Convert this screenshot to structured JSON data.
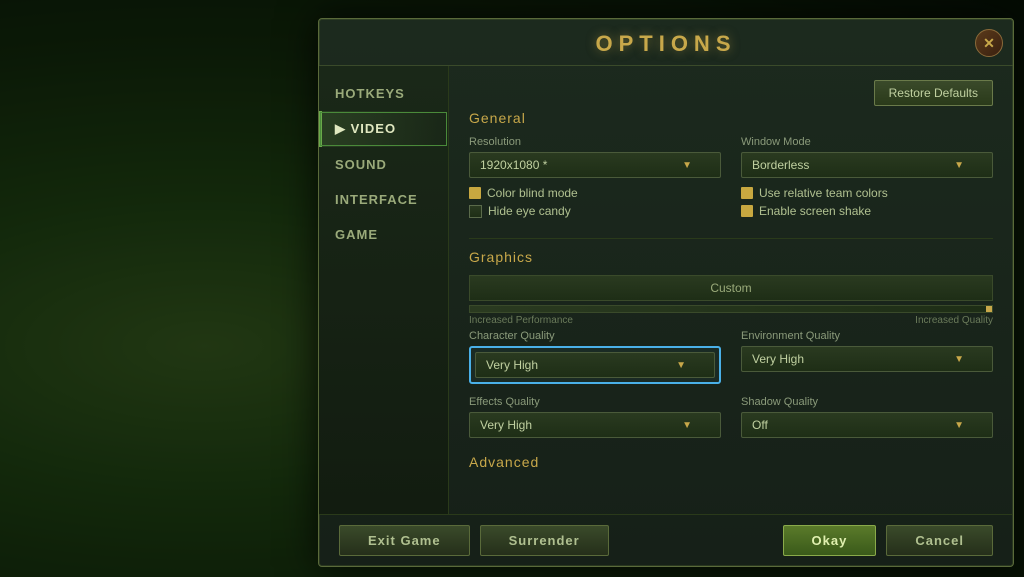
{
  "dialog": {
    "title": "OPTIONS",
    "close_label": "✕"
  },
  "sidebar": {
    "items": [
      {
        "id": "hotkeys",
        "label": "HOTKEYS",
        "active": false
      },
      {
        "id": "video",
        "label": "VIDEO",
        "active": true
      },
      {
        "id": "sound",
        "label": "SOUND",
        "active": false
      },
      {
        "id": "interface",
        "label": "INTERFACE",
        "active": false
      },
      {
        "id": "game",
        "label": "GAME",
        "active": false
      }
    ]
  },
  "toolbar": {
    "restore_label": "Restore Defaults"
  },
  "general": {
    "title": "General",
    "resolution": {
      "label": "Resolution",
      "value": "1920x1080 *"
    },
    "window_mode": {
      "label": "Window Mode",
      "value": "Borderless"
    },
    "color_blind_mode": {
      "label": "Color blind mode",
      "checked": true
    },
    "use_relative_team_colors": {
      "label": "Use relative team colors",
      "checked": true
    },
    "hide_eye_candy": {
      "label": "Hide eye candy",
      "checked": false
    },
    "enable_screen_shake": {
      "label": "Enable screen shake",
      "checked": true
    }
  },
  "graphics": {
    "title": "Graphics",
    "preset": "Custom",
    "performance_label": "Increased Performance",
    "quality_label": "Increased Quality",
    "character_quality": {
      "label": "Character Quality",
      "value": "Very High",
      "highlighted": true
    },
    "environment_quality": {
      "label": "Environment Quality",
      "value": "Very High"
    },
    "effects_quality": {
      "label": "Effects Quality",
      "value": "Very High"
    },
    "shadow_quality": {
      "label": "Shadow Quality",
      "value": "Off"
    }
  },
  "advanced": {
    "title": "Advanced"
  },
  "footer": {
    "exit_game": "Exit Game",
    "surrender": "Surrender",
    "okay": "Okay",
    "cancel": "Cancel"
  }
}
